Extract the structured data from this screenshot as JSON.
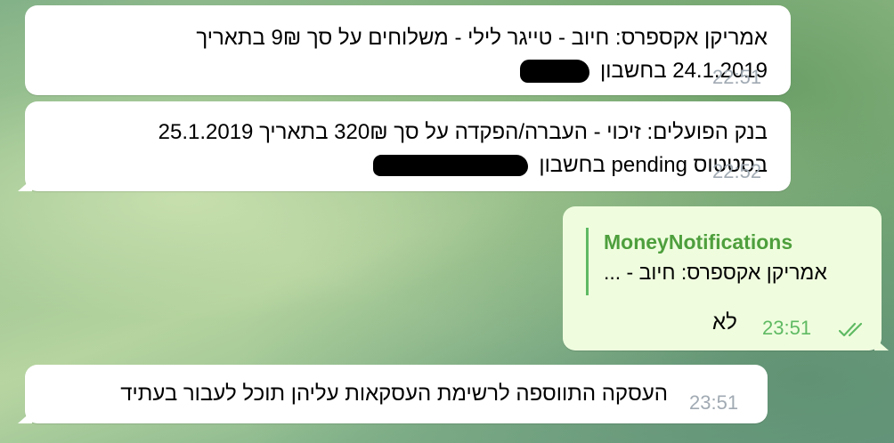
{
  "messages": [
    {
      "direction": "incoming",
      "line1": "אמריקן אקספרס: חיוב - טייגר לילי - משלוחים על סך 9₪ בתאריך",
      "line2": "24.1.2019 בחשבון",
      "time": "22:51"
    },
    {
      "direction": "incoming",
      "line1": "בנק הפועלים: זיכוי - העברה/הפקדה על סך 320₪ בתאריך 25.1.2019",
      "line2": "בסטטוס pending בחשבון",
      "time": "22:52"
    },
    {
      "direction": "outgoing",
      "reply": {
        "name": "MoneyNotifications",
        "text": "אמריקן אקספרס: חיוב - ..."
      },
      "text": "לא",
      "time": "23:51",
      "status_icon": "double-check-icon"
    },
    {
      "direction": "incoming",
      "text": "העסקה התווספה לרשימת העסקאות עליהן תוכל לעבור בעתיד",
      "time": "23:51"
    }
  ],
  "colors": {
    "incoming_bubble": "#ffffff",
    "outgoing_bubble": "#effdde",
    "reply_accent": "#5fba63",
    "timestamp": "#a1aab3"
  }
}
